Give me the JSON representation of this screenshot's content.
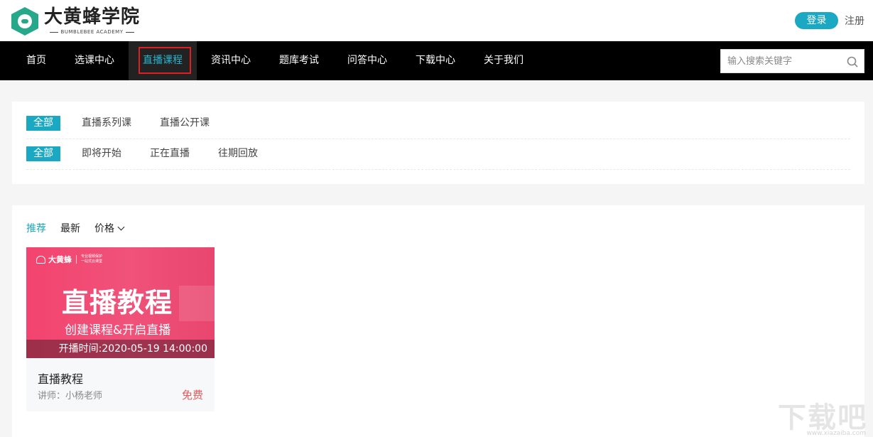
{
  "header": {
    "logo_cn": "大黄蜂学院",
    "logo_en": "BUMBLEBEE ACADEMY",
    "login": "登录",
    "register": "注册"
  },
  "nav": {
    "items": [
      {
        "label": "首页"
      },
      {
        "label": "选课中心"
      },
      {
        "label": "直播课程"
      },
      {
        "label": "资讯中心"
      },
      {
        "label": "题库考试"
      },
      {
        "label": "问答中心"
      },
      {
        "label": "下载中心"
      },
      {
        "label": "关于我们"
      }
    ],
    "active_index": 2,
    "search_placeholder": "输入搜索关键字"
  },
  "filters": {
    "row1": [
      "全部",
      "直播系列课",
      "直播公开课"
    ],
    "row2": [
      "全部",
      "即将开始",
      "正在直播",
      "往期回放"
    ]
  },
  "sort": {
    "items": [
      "推荐",
      "最新",
      "价格"
    ],
    "selected": "推荐"
  },
  "course": {
    "thumb_brand": "大黄蜂",
    "thumb_tagline_1": "专业视频保护",
    "thumb_tagline_2": "一站式云课堂",
    "thumb_title": "直播教程",
    "thumb_subtitle": "创建课程&开启直播",
    "thumb_time": "开播时间:2020-05-19 14:00:00",
    "title": "直播教程",
    "teacher": "讲师：小杨老师",
    "price": "免费"
  },
  "watermark": {
    "text": "下载吧",
    "url": "www.xiazaiba.com"
  },
  "colors": {
    "accent": "#1aa8c2",
    "nav_bg": "#000000",
    "price": "#e05a5a",
    "highlight_box": "#e02020"
  }
}
